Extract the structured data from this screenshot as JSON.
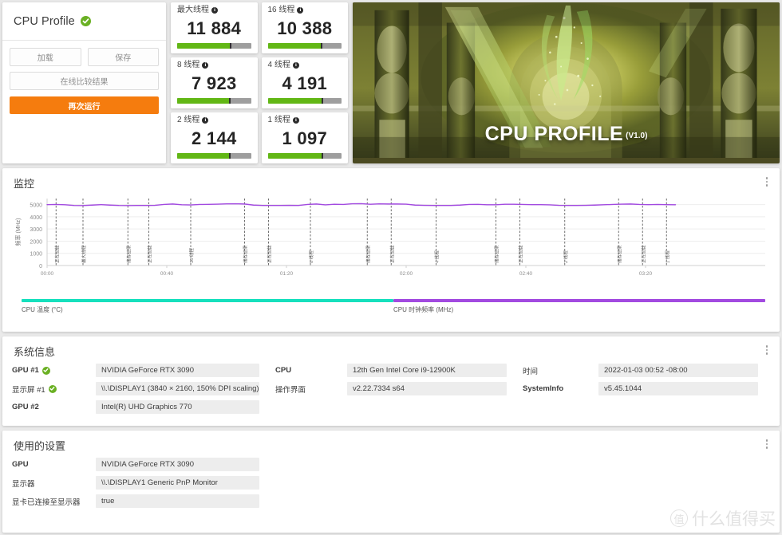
{
  "result_panel": {
    "title": "CPU Profile",
    "status_icon": "check-circle-icon",
    "buttons": {
      "load": "加载",
      "save": "保存",
      "compare_online": "在线比较结果",
      "run_again": "再次运行"
    }
  },
  "scores": [
    {
      "label": "最大线程",
      "value": "11 884",
      "fill_pct": 71,
      "tick_pct": 71
    },
    {
      "label": "16 线程",
      "value": "10 388",
      "fill_pct": 72,
      "tick_pct": 72
    },
    {
      "label": "8 线程",
      "value": "7 923",
      "fill_pct": 70,
      "tick_pct": 70
    },
    {
      "label": "4 线程",
      "value": "4 191",
      "fill_pct": 73,
      "tick_pct": 73
    },
    {
      "label": "2 线程",
      "value": "2 144",
      "fill_pct": 70,
      "tick_pct": 70
    },
    {
      "label": "1 线程",
      "value": "1 097",
      "fill_pct": 73,
      "tick_pct": 73
    }
  ],
  "banner": {
    "caption": "CPU PROFILE",
    "version": "(V1.0)"
  },
  "monitoring": {
    "title": "监控",
    "menu_icon": "kebab-menu-icon",
    "legend": [
      {
        "label": "CPU 温度 (°C)",
        "color": "#16e0bd"
      },
      {
        "label": "CPU 时钟频率 (MHz)",
        "color": "#a24ae0"
      }
    ]
  },
  "chart_data": {
    "type": "line",
    "title": "监控",
    "xlabel": "",
    "ylabel": "频率 (MHz)",
    "ylim": [
      0,
      5500
    ],
    "yticks": [
      0,
      1000,
      2000,
      3000,
      4000,
      5000
    ],
    "ytick_labels": [
      "0",
      "1000",
      "2000",
      "3000",
      "4000",
      "5000"
    ],
    "xticks": [
      0,
      40,
      80,
      120,
      160,
      200
    ],
    "xtick_labels": [
      "00:00",
      "00:40",
      "01:20",
      "02:00",
      "02:40",
      "03:20"
    ],
    "grid": true,
    "legend_position": "bottom",
    "series": [
      {
        "name": "CPU 时钟频率 (MHz)",
        "color": "#a24ae0",
        "x": [
          0,
          3,
          6,
          9,
          12,
          15,
          18,
          21,
          24,
          27,
          30,
          33,
          36,
          39,
          42,
          45,
          48,
          51,
          54,
          57,
          60,
          63,
          66,
          69,
          72,
          75,
          78,
          81,
          84,
          87,
          90,
          93,
          96,
          99,
          102,
          105,
          108,
          111,
          114,
          117,
          120,
          123,
          126,
          129,
          132,
          135,
          138,
          141,
          144,
          147,
          150,
          153,
          156,
          159,
          162,
          165,
          168,
          171,
          174,
          177,
          180,
          183,
          186,
          189,
          192,
          195,
          198,
          201,
          204,
          207,
          210
        ],
        "values": [
          5000,
          5010,
          4990,
          4930,
          4920,
          4960,
          5000,
          4960,
          4930,
          4920,
          4930,
          4930,
          4940,
          5010,
          5050,
          4990,
          4970,
          5010,
          5020,
          5040,
          5060,
          5070,
          5050,
          4960,
          4930,
          4930,
          4930,
          4940,
          4930,
          5010,
          5050,
          4980,
          5030,
          5010,
          5070,
          5080,
          5030,
          5060,
          5050,
          5050,
          5040,
          4960,
          4940,
          4930,
          4930,
          4930,
          4960,
          5010,
          5020,
          4990,
          4990,
          5030,
          5030,
          5010,
          5000,
          5000,
          4980,
          4940,
          4930,
          4930,
          4940,
          4960,
          4990,
          5010,
          5040,
          5050,
          5010,
          5000,
          5010,
          5000,
          4990
        ]
      }
    ],
    "markers": [
      {
        "x": 3,
        "label": "正在加载"
      },
      {
        "x": 12,
        "label": "最大线程"
      },
      {
        "x": 27,
        "label": "储存结果"
      },
      {
        "x": 34,
        "label": "正在加载"
      },
      {
        "x": 48,
        "label": "16 线程"
      },
      {
        "x": 66,
        "label": "储存结果"
      },
      {
        "x": 74,
        "label": "正在加载"
      },
      {
        "x": 88,
        "label": "8 线程"
      },
      {
        "x": 107,
        "label": "储存结果"
      },
      {
        "x": 115,
        "label": "正在加载"
      },
      {
        "x": 130,
        "label": "4 线程"
      },
      {
        "x": 150,
        "label": "储存结果"
      },
      {
        "x": 158,
        "label": "正在加载"
      },
      {
        "x": 173,
        "label": "2 线程"
      },
      {
        "x": 191,
        "label": "储存结果"
      },
      {
        "x": 199,
        "label": "正在加载"
      },
      {
        "x": 207,
        "label": "1 线程"
      }
    ]
  },
  "system_info": {
    "title": "系统信息",
    "menu_icon": "kebab-menu-icon",
    "left_rows": [
      {
        "key": "GPU #1",
        "value": "NVIDIA GeForce RTX 3090",
        "bold": true,
        "check": true
      },
      {
        "key": "显示屏 #1",
        "value": "\\\\.\\DISPLAY1 (3840 × 2160, 150% DPI scaling)",
        "bold": false,
        "check": true
      },
      {
        "key": "GPU #2",
        "value": "Intel(R) UHD Graphics 770",
        "bold": true,
        "check": false
      }
    ],
    "mid_rows": [
      {
        "key": "CPU",
        "value": "12th Gen Intel Core i9-12900K",
        "bold": true,
        "check": false
      },
      {
        "key": "操作界面",
        "value": "v2.22.7334 s64",
        "bold": false,
        "check": false
      }
    ],
    "right_rows": [
      {
        "key": "时间",
        "value": "2022-01-03 00:52 -08:00",
        "bold": false,
        "check": false
      },
      {
        "key": "SystemInfo",
        "value": "v5.45.1044",
        "bold": true,
        "check": false
      }
    ]
  },
  "settings": {
    "title": "使用的设置",
    "menu_icon": "kebab-menu-icon",
    "rows": [
      {
        "key": "GPU",
        "value": "NVIDIA GeForce RTX 3090",
        "bold": true,
        "check": false
      },
      {
        "key": "显示器",
        "value": "\\\\.\\DISPLAY1 Generic PnP Monitor",
        "bold": false,
        "check": false
      },
      {
        "key": "显卡已连接至显示器",
        "value": "true",
        "bold": false,
        "check": false
      }
    ]
  },
  "watermark": {
    "logo_char": "值",
    "text": "什么值得买"
  }
}
